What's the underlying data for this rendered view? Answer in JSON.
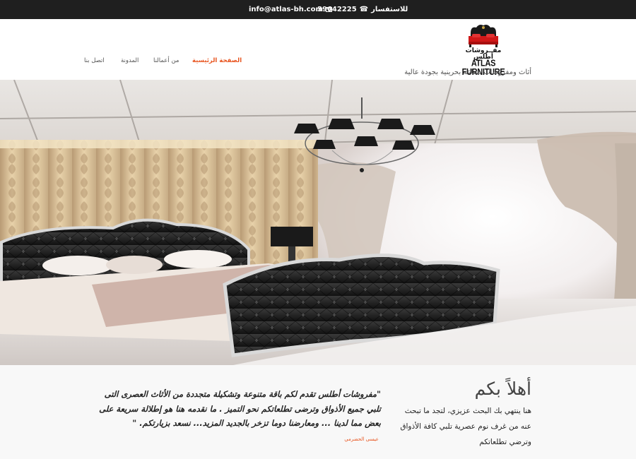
{
  "topbar": {
    "phone_label": "للاستفسار",
    "phone": "39642225",
    "email": "info@atlas-bh.com"
  },
  "logo": {
    "arabic": "مفــروشات أطلس",
    "english": "ATLAS FURNITURE",
    "tagline": "أثاث ومفروشات صناعة بحرينية بجودة عالية"
  },
  "nav": [
    {
      "label": "الصفحة الرئيسية",
      "active": true
    },
    {
      "label": "من أعمالنا",
      "active": false
    },
    {
      "label": "المدونة",
      "active": false
    },
    {
      "label": "اتصل بنا",
      "active": false
    }
  ],
  "hero": {
    "description": "Bedroom photo with black tufted bed and chandelier"
  },
  "welcome": {
    "title": "أهلاً بكم",
    "text": "هنا ينتهي بك البحث عزيزي، لتجد ما تبحث عنه من غرف نوم عصرية تلبي كافة الأذواق وترضي تطلعاتكم"
  },
  "quote": {
    "text": "\"مفروشات أطلس تقدم لكم باقة متنوعة وتشكيلة متجددة من الأثاث العصرى التى تلبي جميع الأذواق وترضى تطلعاتكم نحو التميز . ما نقدمه هنا هو إطلالة سريعة على بعض مما لدينا ... ومعارضنا دوما تزخر بالجديد المزيد... نسعد بزيارتكم. \"",
    "author": "عيسى الحضرمي"
  },
  "colors": {
    "accent": "#e8541f",
    "topbar": "#1f1f1f"
  }
}
